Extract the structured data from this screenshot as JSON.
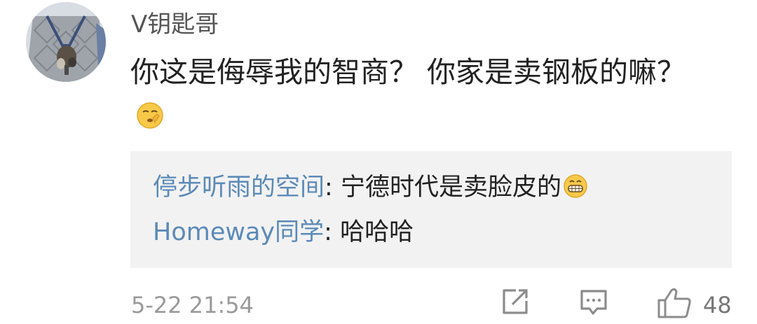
{
  "comment": {
    "username": "V钥匙哥",
    "content_text": "你这是侮辱我的智商？ 你家是卖钢板的嘛？",
    "content_emoji": "shushing-face-emoji",
    "replies": [
      {
        "user": "停步听雨的空间",
        "separator": ": ",
        "text": "宁德时代是卖脸皮的",
        "emoji": "grinning-face-emoji"
      },
      {
        "user": "Homeway同学",
        "separator": ": ",
        "text": "哈哈哈"
      }
    ],
    "timestamp": "5-22 21:54",
    "like_count": "48"
  },
  "icons": {
    "share": "share-icon",
    "comment": "comment-icon",
    "like": "thumbs-up-icon"
  },
  "colors": {
    "username": "#555555",
    "content": "#222222",
    "reply_user": "#5b8ab7",
    "reply_bg": "#f2f2f2",
    "meta": "#9a9a9a",
    "icon": "#8c8c8c"
  }
}
